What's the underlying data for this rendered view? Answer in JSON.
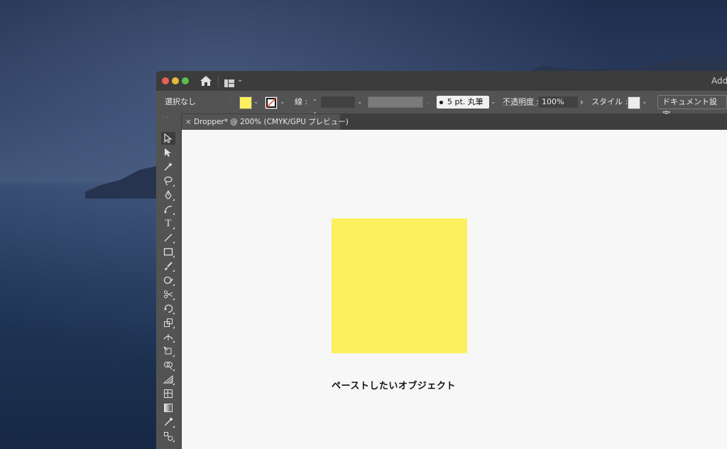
{
  "window": {
    "app_name_partial": "Add"
  },
  "control_bar": {
    "selection_label": "選択なし",
    "fill_color": "#fcf05e",
    "stroke_label": "線 :",
    "brush_label": "5 pt. 丸筆",
    "opacity_label": "不透明度 :",
    "opacity_value": "100%",
    "opacity_more": "›",
    "style_label": "スタイル :",
    "document_setup_label": "ドキュメント設定"
  },
  "document_tab": {
    "close": "×",
    "title": "Dropper* @ 200% (CMYK/GPU プレビュー)"
  },
  "toolbar": {
    "tools": [
      "selection",
      "direct-selection",
      "magic-wand",
      "lasso",
      "pen",
      "curvature",
      "type",
      "line-segment",
      "rectangle",
      "paintbrush",
      "shaper",
      "scissors",
      "rotate",
      "scale",
      "width",
      "free-transform",
      "shape-builder",
      "perspective-grid",
      "mesh",
      "gradient",
      "eyedropper",
      "blend"
    ]
  },
  "artboard": {
    "object_color": "#fcf05e",
    "caption": "ペーストしたいオブジェクト"
  }
}
